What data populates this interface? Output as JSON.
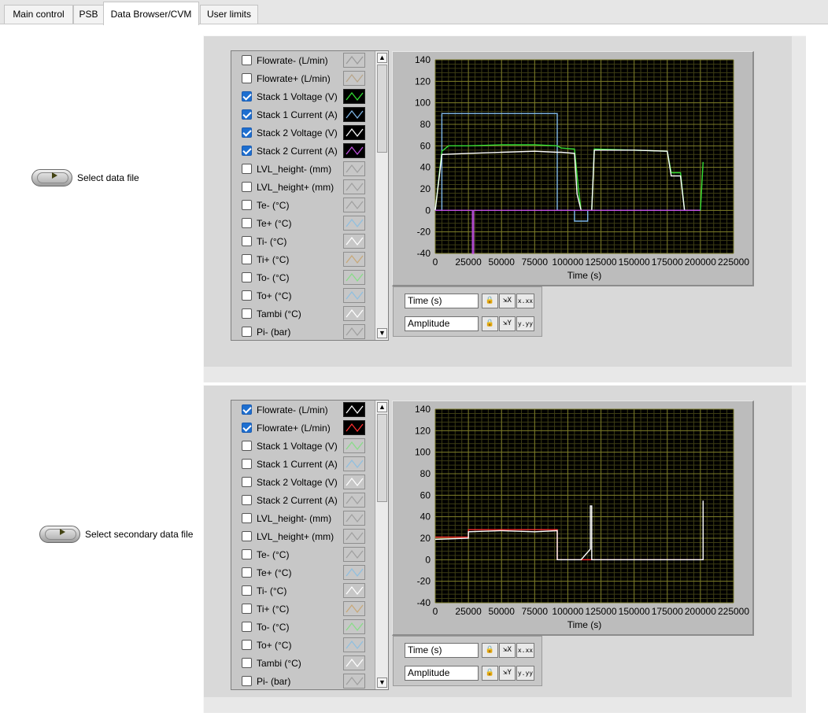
{
  "tabs": [
    {
      "label": "Main control",
      "active": false
    },
    {
      "label": "PSB",
      "active": false
    },
    {
      "label": "Data Browser/CVM",
      "active": true
    },
    {
      "label": "User limits",
      "active": false
    }
  ],
  "file_buttons": {
    "primary_label": "Select data file",
    "secondary_label": "Select secondary data file"
  },
  "panels": [
    {
      "legend": [
        {
          "label": "Flowrate- (L/min)",
          "checked": false,
          "color": "#9a9a9a"
        },
        {
          "label": "Flowrate+ (L/min)",
          "checked": false,
          "color": "#b8a58a"
        },
        {
          "label": "Stack 1 Voltage (V)",
          "checked": true,
          "color": "#33dd33"
        },
        {
          "label": "Stack 1 Current (A)",
          "checked": true,
          "color": "#7fb7e8"
        },
        {
          "label": "Stack 2 Voltage (V)",
          "checked": true,
          "color": "#ffffff"
        },
        {
          "label": "Stack 2 Current (A)",
          "checked": true,
          "color": "#c050e0"
        },
        {
          "label": "LVL_height- (mm)",
          "checked": false,
          "color": "#a0a0a0"
        },
        {
          "label": "LVL_height+ (mm)",
          "checked": false,
          "color": "#a0a0a0"
        },
        {
          "label": "Te- (°C)",
          "checked": false,
          "color": "#a0a0a0"
        },
        {
          "label": "Te+ (°C)",
          "checked": false,
          "color": "#8fbfe0"
        },
        {
          "label": "Ti- (°C)",
          "checked": false,
          "color": "#ffffff"
        },
        {
          "label": "Ti+ (°C)",
          "checked": false,
          "color": "#c8a878"
        },
        {
          "label": "To- (°C)",
          "checked": false,
          "color": "#88dd88"
        },
        {
          "label": "To+ (°C)",
          "checked": false,
          "color": "#8fbfe0"
        },
        {
          "label": "Tambi (°C)",
          "checked": false,
          "color": "#ffffff"
        },
        {
          "label": "Pi- (bar)",
          "checked": false,
          "color": "#a0a0a0"
        }
      ],
      "scale": {
        "x_name": "Time (s)",
        "y_name": "Amplitude",
        "x_format": "x.xx",
        "y_format": "y.yy"
      }
    },
    {
      "legend": [
        {
          "label": "Flowrate- (L/min)",
          "checked": true,
          "color": "#ffffff"
        },
        {
          "label": "Flowrate+ (L/min)",
          "checked": true,
          "color": "#ff3030"
        },
        {
          "label": "Stack 1 Voltage (V)",
          "checked": false,
          "color": "#88dd88"
        },
        {
          "label": "Stack 1 Current (A)",
          "checked": false,
          "color": "#8fbfe0"
        },
        {
          "label": "Stack 2 Voltage (V)",
          "checked": false,
          "color": "#ffffff"
        },
        {
          "label": "Stack 2 Current (A)",
          "checked": false,
          "color": "#a0a0a0"
        },
        {
          "label": "LVL_height- (mm)",
          "checked": false,
          "color": "#a0a0a0"
        },
        {
          "label": "LVL_height+ (mm)",
          "checked": false,
          "color": "#a0a0a0"
        },
        {
          "label": "Te- (°C)",
          "checked": false,
          "color": "#a0a0a0"
        },
        {
          "label": "Te+ (°C)",
          "checked": false,
          "color": "#8fbfe0"
        },
        {
          "label": "Ti- (°C)",
          "checked": false,
          "color": "#ffffff"
        },
        {
          "label": "Ti+ (°C)",
          "checked": false,
          "color": "#c8a878"
        },
        {
          "label": "To- (°C)",
          "checked": false,
          "color": "#88dd88"
        },
        {
          "label": "To+ (°C)",
          "checked": false,
          "color": "#8fbfe0"
        },
        {
          "label": "Tambi (°C)",
          "checked": false,
          "color": "#ffffff"
        },
        {
          "label": "Pi- (bar)",
          "checked": false,
          "color": "#a0a0a0"
        }
      ],
      "scale": {
        "x_name": "Time (s)",
        "y_name": "Amplitude",
        "x_format": "x.xx",
        "y_format": "y.yy"
      }
    }
  ],
  "chart_data": [
    {
      "type": "line",
      "xlabel": "Time (s)",
      "xlim": [
        0,
        225000
      ],
      "ylim": [
        -40,
        140
      ],
      "x_ticks": [
        "0",
        "25000",
        "50000",
        "75000",
        "100000",
        "125000",
        "150000",
        "175000",
        "200000",
        "225000"
      ],
      "y_ticks": [
        "140",
        "120",
        "100",
        "80",
        "60",
        "40",
        "20",
        "0",
        "-20",
        "-40"
      ],
      "grid": true,
      "colors": {
        "plot_bg": "#000000",
        "grid": "#7a7a28"
      },
      "series": [
        {
          "color": "#7fb7e8",
          "x": [
            0,
            5000,
            5000,
            92000,
            92000,
            105000,
            105000,
            115000,
            115000,
            200000
          ],
          "y": [
            0,
            0,
            90,
            90,
            0,
            0,
            -10,
            -10,
            0,
            0
          ]
        },
        {
          "color": "#33dd33",
          "x": [
            0,
            5000,
            10000,
            25000,
            50000,
            75000,
            92000,
            95000,
            105000,
            108000,
            110000,
            118000,
            120000,
            150000,
            175000,
            178000,
            185000,
            188000,
            200000,
            202000
          ],
          "y": [
            0,
            55,
            60,
            60,
            61,
            61,
            60,
            58,
            57,
            20,
            0,
            0,
            57,
            56,
            55,
            35,
            35,
            0,
            0,
            45
          ]
        },
        {
          "color": "#ffffff",
          "x": [
            0,
            5000,
            25000,
            50000,
            75000,
            92000,
            95000,
            105000,
            107000,
            110000,
            118000,
            120000,
            150000,
            175000,
            178000,
            185000,
            188000,
            200000
          ],
          "y": [
            0,
            52,
            53,
            54,
            55,
            54,
            54,
            53,
            15,
            0,
            0,
            56,
            56,
            55,
            32,
            32,
            0,
            0
          ]
        },
        {
          "color": "#c050e0",
          "x": [
            0,
            28000,
            28000,
            29000,
            29000,
            200000
          ],
          "y": [
            0,
            0,
            -40,
            -40,
            0,
            0
          ]
        }
      ]
    },
    {
      "type": "line",
      "xlabel": "Time (s)",
      "xlim": [
        0,
        225000
      ],
      "ylim": [
        -40,
        140
      ],
      "x_ticks": [
        "0",
        "25000",
        "50000",
        "75000",
        "100000",
        "125000",
        "150000",
        "175000",
        "200000",
        "225000"
      ],
      "y_ticks": [
        "140",
        "120",
        "100",
        "80",
        "60",
        "40",
        "20",
        "0",
        "-20",
        "-40"
      ],
      "grid": true,
      "colors": {
        "plot_bg": "#000000",
        "grid": "#7a7a28"
      },
      "series": [
        {
          "color": "#ff3030",
          "x": [
            0,
            25000,
            25000,
            92000,
            92000,
            115000,
            118000,
            120000,
            122000,
            200000,
            202000
          ],
          "y": [
            21,
            21,
            28,
            28,
            0,
            0,
            0,
            0,
            0,
            0,
            0
          ]
        },
        {
          "color": "#ffffff",
          "x": [
            0,
            25000,
            25000,
            50000,
            75000,
            92000,
            92000,
            110000,
            117000,
            117000,
            118000,
            118000,
            120000,
            200000,
            202000,
            202000
          ],
          "y": [
            19,
            20,
            26,
            27,
            26,
            27,
            0,
            0,
            10,
            50,
            50,
            0,
            0,
            0,
            0,
            55
          ]
        }
      ]
    }
  ]
}
